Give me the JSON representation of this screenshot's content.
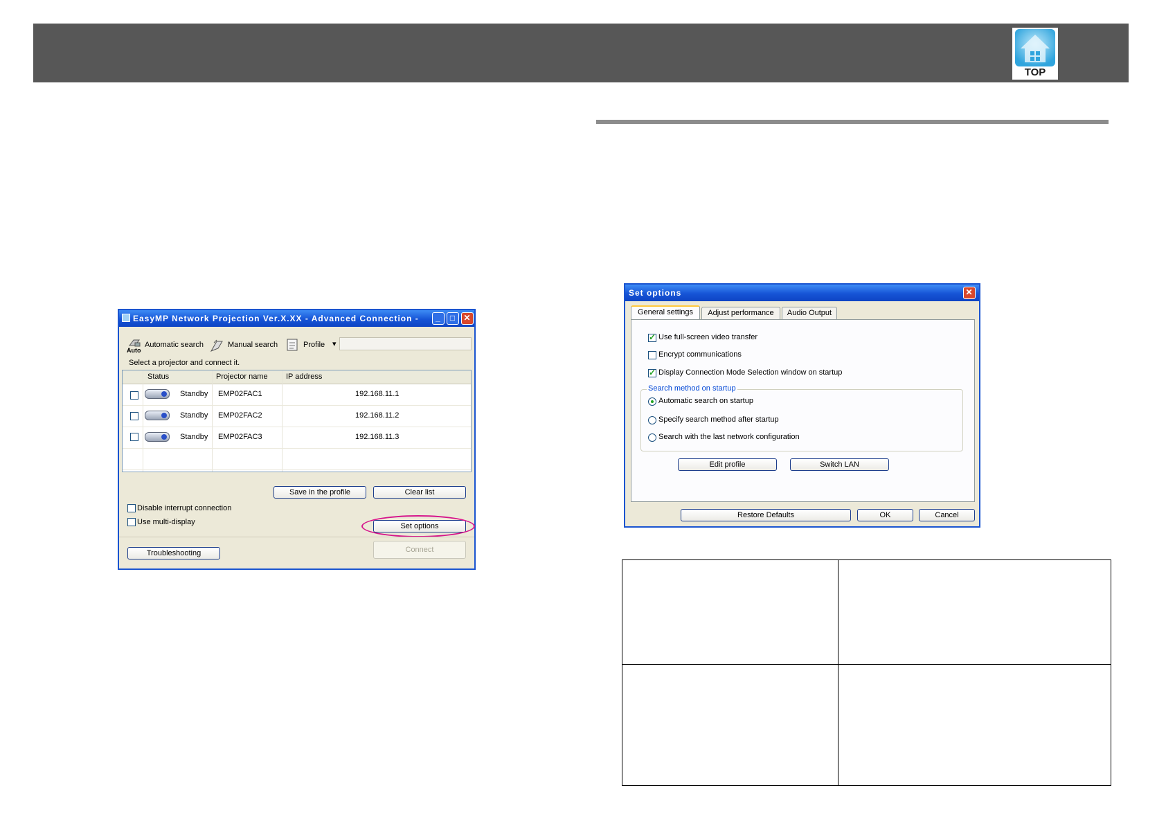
{
  "header": {
    "logo_text": "TOP",
    "logo_icon": "house-icon"
  },
  "left_window": {
    "title": "EasyMP Network Projection Ver.X.XX - Advanced Connection -",
    "toolbar": {
      "auto_icon_label": "Auto",
      "automatic_search": "Automatic search",
      "manual_search": "Manual search",
      "profile": "Profile"
    },
    "instruction": "Select a projector and connect it.",
    "columns": [
      "Status",
      "Projector name",
      "IP address"
    ],
    "rows": [
      {
        "status": "Standby",
        "name": "EMP02FAC1",
        "ip": "192.168.11.1"
      },
      {
        "status": "Standby",
        "name": "EMP02FAC2",
        "ip": "192.168.11.2"
      },
      {
        "status": "Standby",
        "name": "EMP02FAC3",
        "ip": "192.168.11.3"
      }
    ],
    "save_profile": "Save in the profile",
    "clear_list": "Clear list",
    "disable_interrupt": "Disable interrupt connection",
    "use_multi_display": "Use multi-display",
    "set_options": "Set options",
    "troubleshooting": "Troubleshooting",
    "connect": "Connect",
    "highlight_color": "#d6168c"
  },
  "right_window": {
    "title": "Set options",
    "tabs": [
      "General settings",
      "Adjust performance",
      "Audio Output"
    ],
    "checkboxes": [
      {
        "label": "Use full-screen video transfer",
        "checked": true
      },
      {
        "label": "Encrypt communications",
        "checked": false
      },
      {
        "label": "Display Connection Mode Selection window on startup",
        "checked": true
      }
    ],
    "group_label": "Search method on startup",
    "radios": [
      {
        "label": "Automatic search on startup",
        "selected": true
      },
      {
        "label": "Specify search method after startup",
        "selected": false
      },
      {
        "label": "Search with the last network configuration",
        "selected": false
      }
    ],
    "edit_profile": "Edit profile",
    "switch_lan": "Switch LAN",
    "restore_defaults": "Restore Defaults",
    "ok": "OK",
    "cancel": "Cancel"
  }
}
